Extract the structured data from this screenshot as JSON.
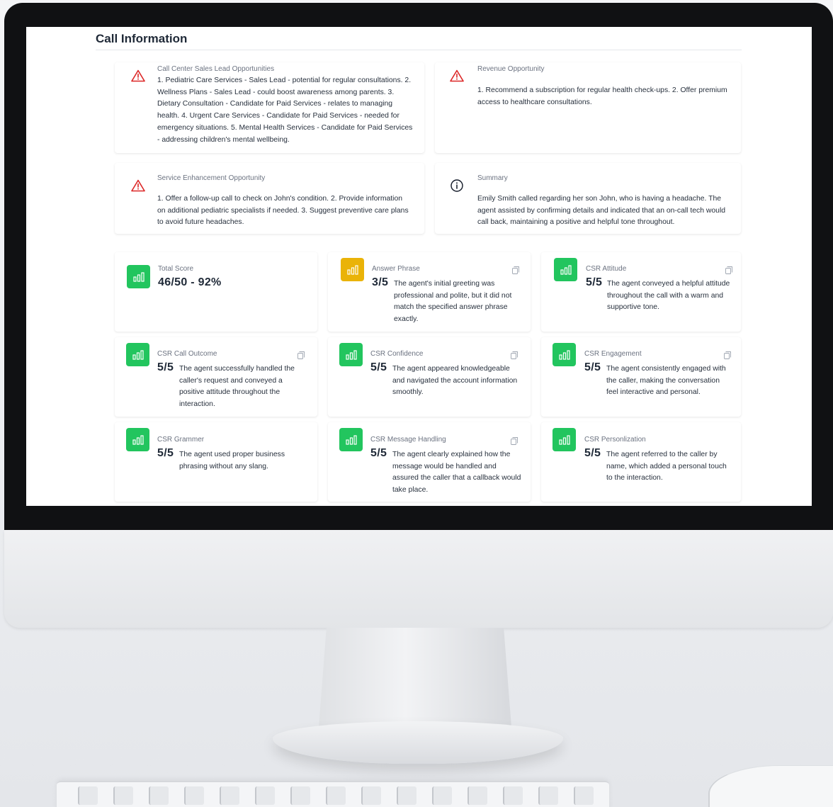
{
  "page": {
    "title": "Call Information"
  },
  "insights": [
    {
      "label": "Call Center Sales Lead Opportunities",
      "icon": "warning-triangle-icon",
      "text": "1. Pediatric Care Services - Sales Lead - potential for regular consultations. 2. Wellness Plans - Sales Lead - could boost awareness among parents. 3. Dietary Consultation - Candidate for Paid Services - relates to managing health. 4. Urgent Care Services - Candidate for Paid Services - needed for emergency situations. 5. Mental Health Services - Candidate for Paid Services - addressing children's mental wellbeing."
    },
    {
      "label": "Revenue Opportunity",
      "icon": "warning-triangle-icon",
      "text": "1. Recommend a subscription for regular health check-ups. 2. Offer premium access to healthcare consultations."
    },
    {
      "label": "Service Enhancement Opportunity",
      "icon": "warning-triangle-icon",
      "text": "1. Offer a follow-up call to check on John's condition. 2. Provide information on additional pediatric specialists if needed. 3. Suggest preventive care plans to avoid future headaches."
    },
    {
      "label": "Summary",
      "icon": "info-circle-icon",
      "text": "Emily Smith called regarding her son John, who is having a headache. The agent assisted by confirming details and indicated that an on-call tech would call back, maintaining a positive and helpful tone throughout."
    }
  ],
  "scores": [
    {
      "label": "Total Score",
      "score": "46/50 - 92%",
      "text": "",
      "color": "#22c55e",
      "icon": "bar-chart-icon"
    },
    {
      "label": "Answer Phrase",
      "score": "3/5",
      "text": "The agent's initial greeting was professional and polite, but it did not match the specified answer phrase exactly.",
      "color": "#eab308",
      "icon": "bar-chart-icon"
    },
    {
      "label": "CSR Attitude",
      "score": "5/5",
      "text": "The agent conveyed a helpful attitude throughout the call with a warm and supportive tone.",
      "color": "#22c55e",
      "icon": "bar-chart-icon"
    },
    {
      "label": "CSR Call Outcome",
      "score": "5/5",
      "text": "The agent successfully handled the caller's request and conveyed a positive attitude throughout the interaction.",
      "color": "#22c55e",
      "icon": "bar-chart-icon"
    },
    {
      "label": "CSR Confidence",
      "score": "5/5",
      "text": "The agent appeared knowledgeable and navigated the account information smoothly.",
      "color": "#22c55e",
      "icon": "bar-chart-icon"
    },
    {
      "label": "CSR Engagement",
      "score": "5/5",
      "text": "The agent consistently engaged with the caller, making the conversation feel interactive and personal.",
      "color": "#22c55e",
      "icon": "bar-chart-icon"
    },
    {
      "label": "CSR Grammer",
      "score": "5/5",
      "text": "The agent used proper business phrasing without any slang.",
      "color": "#22c55e",
      "icon": "bar-chart-icon"
    },
    {
      "label": "CSR Message Handling",
      "score": "5/5",
      "text": "The agent clearly explained how the message would be handled and assured the caller that a callback would take place.",
      "color": "#22c55e",
      "icon": "bar-chart-icon"
    },
    {
      "label": "CSR Personlization",
      "score": "5/5",
      "text": "The agent referred to the caller by name, which added a personal touch to the interaction.",
      "color": "#22c55e",
      "icon": "bar-chart-icon"
    }
  ]
}
